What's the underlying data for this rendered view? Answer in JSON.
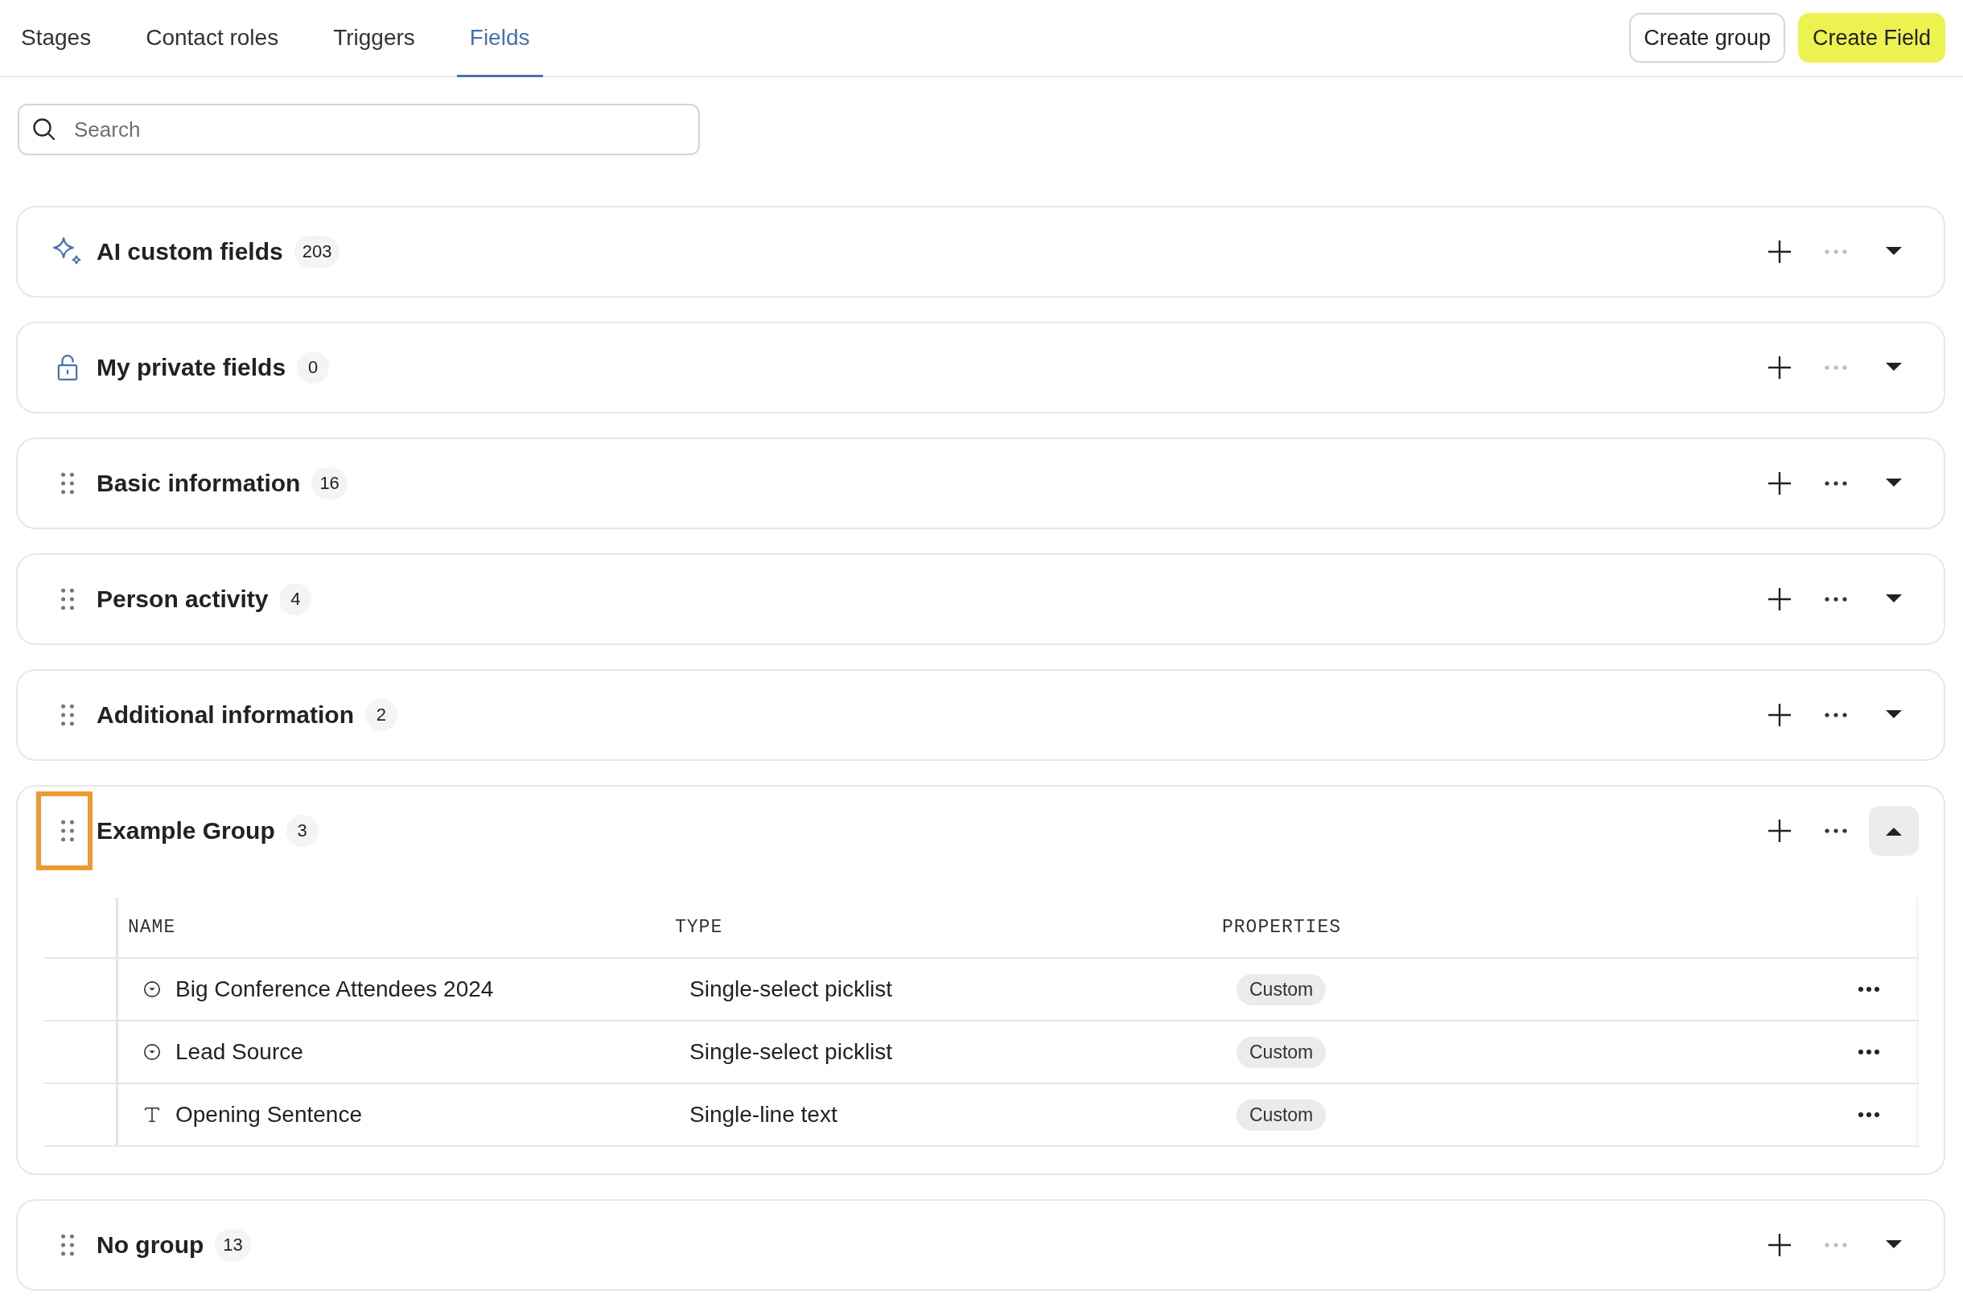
{
  "tabs": [
    {
      "label": "Stages",
      "selected": false
    },
    {
      "label": "Contact roles",
      "selected": false
    },
    {
      "label": "Triggers",
      "selected": false
    },
    {
      "label": "Fields",
      "selected": true
    }
  ],
  "buttons": [
    {
      "label": "Create group",
      "kind": "secondary"
    },
    {
      "label": "Create Field",
      "kind": "primary"
    }
  ],
  "search": {
    "placeholder": "Search"
  },
  "groups": [
    {
      "kind": "ai",
      "title": "AI custom fields",
      "count": "203",
      "more_disabled": true,
      "expanded": false,
      "highlighted": false
    },
    {
      "kind": "private",
      "title": "My private fields",
      "count": "0",
      "more_disabled": true,
      "expanded": false,
      "highlighted": false
    },
    {
      "kind": "custom",
      "title": "Basic information",
      "count": "16",
      "more_disabled": false,
      "expanded": false,
      "highlighted": false
    },
    {
      "kind": "custom",
      "title": "Person activity",
      "count": "4",
      "more_disabled": false,
      "expanded": false,
      "highlighted": false
    },
    {
      "kind": "custom",
      "title": "Additional information",
      "count": "2",
      "more_disabled": false,
      "expanded": false,
      "highlighted": false
    },
    {
      "kind": "custom",
      "title": "Example Group",
      "count": "3",
      "more_disabled": false,
      "expanded": true,
      "highlighted": true,
      "table": {
        "columns": [
          "NAME",
          "TYPE",
          "PROPERTIES"
        ],
        "rows": [
          {
            "kind": "picklist",
            "name": "Big Conference Attendees 2024",
            "type": "Single-select picklist",
            "property": "Custom"
          },
          {
            "kind": "picklist",
            "name": "Lead Source",
            "type": "Single-select picklist",
            "property": "Custom"
          },
          {
            "kind": "text",
            "name": "Opening Sentence",
            "type": "Single-line text",
            "property": "Custom"
          }
        ]
      }
    },
    {
      "kind": "custom",
      "title": "No group",
      "count": "13",
      "more_disabled": true,
      "expanded": false,
      "highlighted": false
    }
  ]
}
